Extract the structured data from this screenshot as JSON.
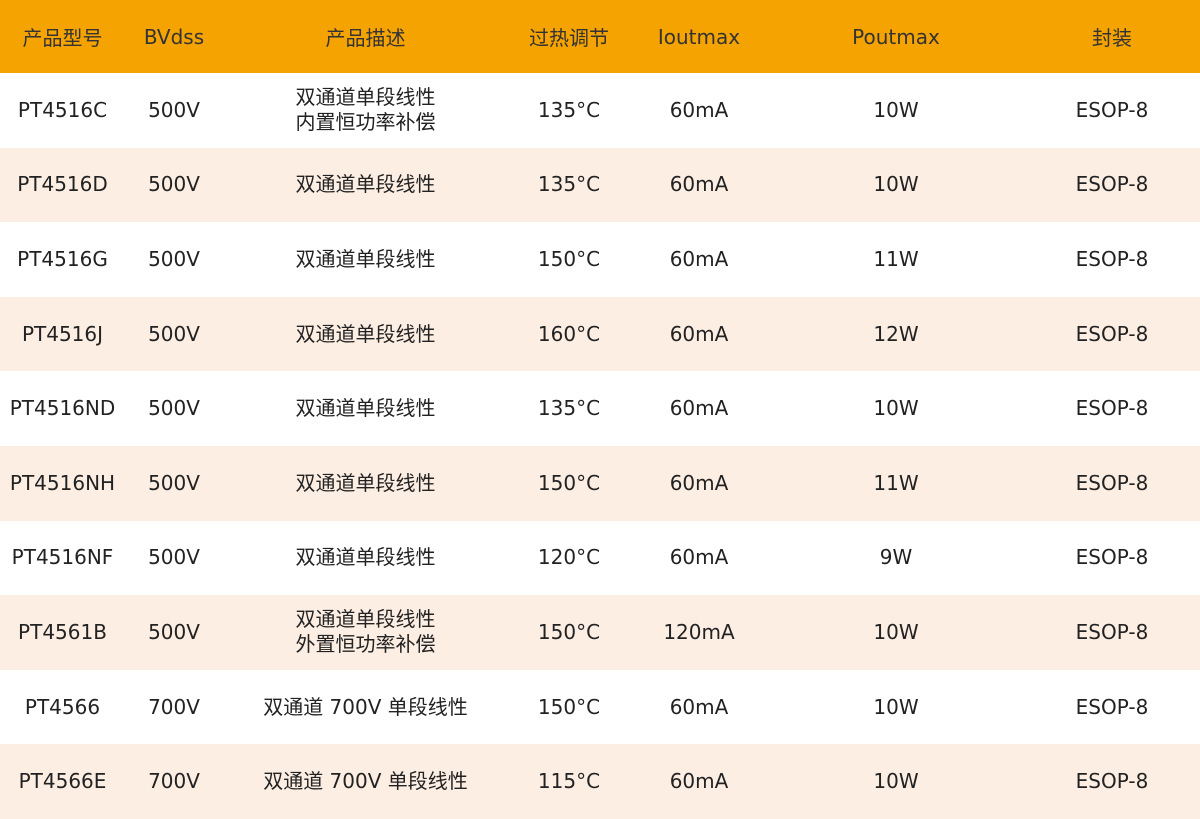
{
  "table": {
    "headers": [
      "产品型号",
      "BVdss",
      "产品描述",
      "过热调节",
      "Ioutmax",
      "Poutmax",
      "封装"
    ],
    "rows": [
      {
        "model": "PT4516C",
        "bvdss": "500V",
        "desc": [
          "双通道单段线性",
          "内置恒功率补偿"
        ],
        "otp": "135°C",
        "iout": "60mA",
        "pout": "10W",
        "pkg": "ESOP-8"
      },
      {
        "model": "PT4516D",
        "bvdss": "500V",
        "desc": [
          "双通道单段线性"
        ],
        "otp": "135°C",
        "iout": "60mA",
        "pout": "10W",
        "pkg": "ESOP-8"
      },
      {
        "model": "PT4516G",
        "bvdss": "500V",
        "desc": [
          "双通道单段线性"
        ],
        "otp": "150°C",
        "iout": "60mA",
        "pout": "11W",
        "pkg": "ESOP-8"
      },
      {
        "model": "PT4516J",
        "bvdss": "500V",
        "desc": [
          "双通道单段线性"
        ],
        "otp": "160°C",
        "iout": "60mA",
        "pout": "12W",
        "pkg": "ESOP-8"
      },
      {
        "model": "PT4516ND",
        "bvdss": "500V",
        "desc": [
          "双通道单段线性"
        ],
        "otp": "135°C",
        "iout": "60mA",
        "pout": "10W",
        "pkg": "ESOP-8"
      },
      {
        "model": "PT4516NH",
        "bvdss": "500V",
        "desc": [
          "双通道单段线性"
        ],
        "otp": "150°C",
        "iout": "60mA",
        "pout": "11W",
        "pkg": "ESOP-8"
      },
      {
        "model": "PT4516NF",
        "bvdss": "500V",
        "desc": [
          "双通道单段线性"
        ],
        "otp": "120°C",
        "iout": "60mA",
        "pout": "9W",
        "pkg": "ESOP-8"
      },
      {
        "model": "PT4561B",
        "bvdss": "500V",
        "desc": [
          "双通道单段线性",
          "外置恒功率补偿"
        ],
        "otp": "150°C",
        "iout": "120mA",
        "pout": "10W",
        "pkg": "ESOP-8"
      },
      {
        "model": "PT4566",
        "bvdss": "700V",
        "desc": [
          "双通道 700V 单段线性"
        ],
        "otp": "150°C",
        "iout": "60mA",
        "pout": "10W",
        "pkg": "ESOP-8"
      },
      {
        "model": "PT4566E",
        "bvdss": "700V",
        "desc": [
          "双通道 700V 单段线性"
        ],
        "otp": "115°C",
        "iout": "60mA",
        "pout": "10W",
        "pkg": "ESOP-8"
      }
    ]
  },
  "colors": {
    "header_bg": "#f5a300",
    "row_alt_bg": "#fdeee4",
    "row_bg": "#ffffff"
  }
}
